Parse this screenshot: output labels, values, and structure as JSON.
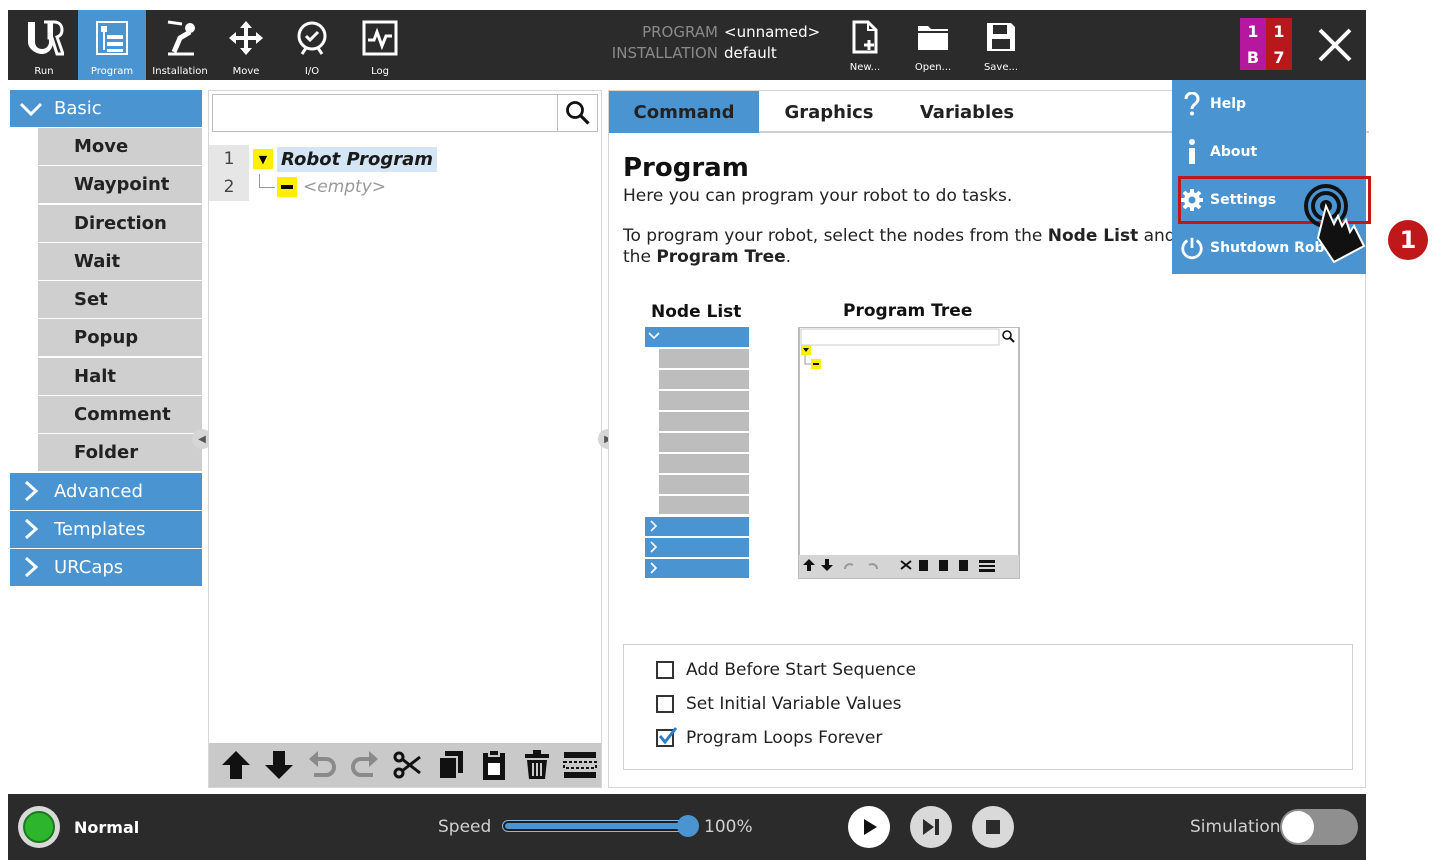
{
  "topbar": {
    "nav": [
      {
        "label": "Run",
        "icon": "ur-logo-icon"
      },
      {
        "label": "Program",
        "icon": "program-icon",
        "active": true
      },
      {
        "label": "Installation",
        "icon": "installation-icon"
      },
      {
        "label": "Move",
        "icon": "move-icon"
      },
      {
        "label": "I/O",
        "icon": "io-icon"
      },
      {
        "label": "Log",
        "icon": "log-icon"
      }
    ],
    "program_key": "PROGRAM",
    "program_value": "<unnamed>",
    "installation_key": "INSTALLATION",
    "installation_value": "default",
    "file_buttons": [
      {
        "label": "New...",
        "icon": "new-file-icon"
      },
      {
        "label": "Open...",
        "icon": "open-folder-icon"
      },
      {
        "label": "Save...",
        "icon": "save-icon"
      }
    ],
    "badge": {
      "tl": "1",
      "tr": "1",
      "bl": "B",
      "br": "7",
      "color_left": "#b5179e",
      "color_right": "#b8171c"
    }
  },
  "node_list": {
    "basic_label": "Basic",
    "basic_items": [
      "Move",
      "Waypoint",
      "Direction",
      "Wait",
      "Set",
      "Popup",
      "Halt",
      "Comment",
      "Folder"
    ],
    "collapsed_categories": [
      "Advanced",
      "Templates",
      "URCaps"
    ]
  },
  "tree": {
    "search_placeholder": "",
    "rows": [
      {
        "num": "1",
        "text": "Robot Program"
      },
      {
        "num": "2",
        "text": "<empty>"
      }
    ]
  },
  "tabs": [
    "Command",
    "Graphics",
    "Variables"
  ],
  "content": {
    "title": "Program",
    "line1": "Here you can program your robot to do tasks.",
    "line2_a": "To program your robot, select the nodes from the ",
    "line2_b": "Node List",
    "line2_c": " and",
    "line3_a": "the ",
    "line3_b": "Program Tree",
    "line3_c": ".",
    "node_list_label": "Node List",
    "program_tree_label": "Program Tree"
  },
  "options": [
    {
      "label": "Add Before Start Sequence",
      "checked": false
    },
    {
      "label": "Set Initial Variable Values",
      "checked": false
    },
    {
      "label": "Program Loops Forever",
      "checked": true
    }
  ],
  "menu": {
    "items": [
      {
        "label": "Help",
        "icon": "help-icon"
      },
      {
        "label": "About",
        "icon": "info-icon"
      },
      {
        "label": "Settings",
        "icon": "gear-icon"
      },
      {
        "label": "Shutdown Robot",
        "icon": "power-icon"
      }
    ],
    "step_number": "1"
  },
  "bottombar": {
    "status": "Normal",
    "speed_label": "Speed",
    "speed_value": "100%",
    "simulation_label": "Simulation"
  },
  "colors": {
    "accent": "#4a95d1",
    "bar": "#2b2b2b",
    "status_green": "#2db52d",
    "highlight": "#c0171b"
  }
}
